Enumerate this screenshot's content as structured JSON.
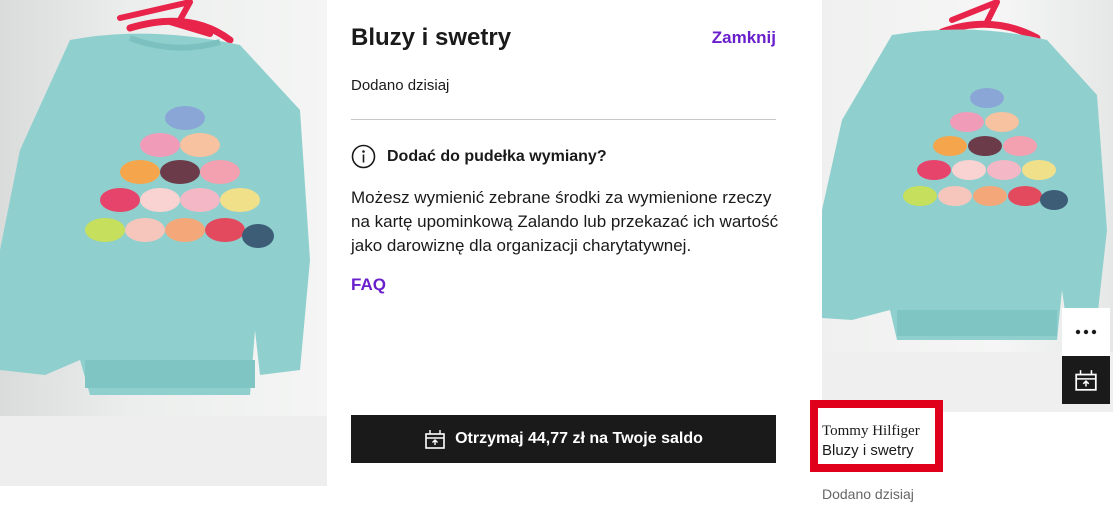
{
  "panel": {
    "title": "Bluzy i swetry",
    "close_label": "Zamknij",
    "added": "Dodano dzisiaj",
    "info_heading": "Dodać do pudełka wymiany?",
    "description": "Możesz wymienić zebrane środki za wymienione rzeczy na kartę upominkową Zalando lub przekazać ich wartość jako darowiznę dla organizacji charytatywnej.",
    "faq_label": "FAQ",
    "cta_label": "Otrzymaj 44,77 zł na Twoje saldo"
  },
  "item_card": {
    "brand": "Tommy Hilfiger",
    "category": "Bluzy i swetry",
    "added": "Dodano dzisiaj"
  },
  "icons": {
    "info": "info-icon",
    "box": "exchange-box-icon",
    "more": "more-dots-icon"
  },
  "colors": {
    "accent": "#6a1fcc",
    "button": "#1a1a1a",
    "highlight": "#e0001b",
    "sweater": "#8fd0ce"
  }
}
